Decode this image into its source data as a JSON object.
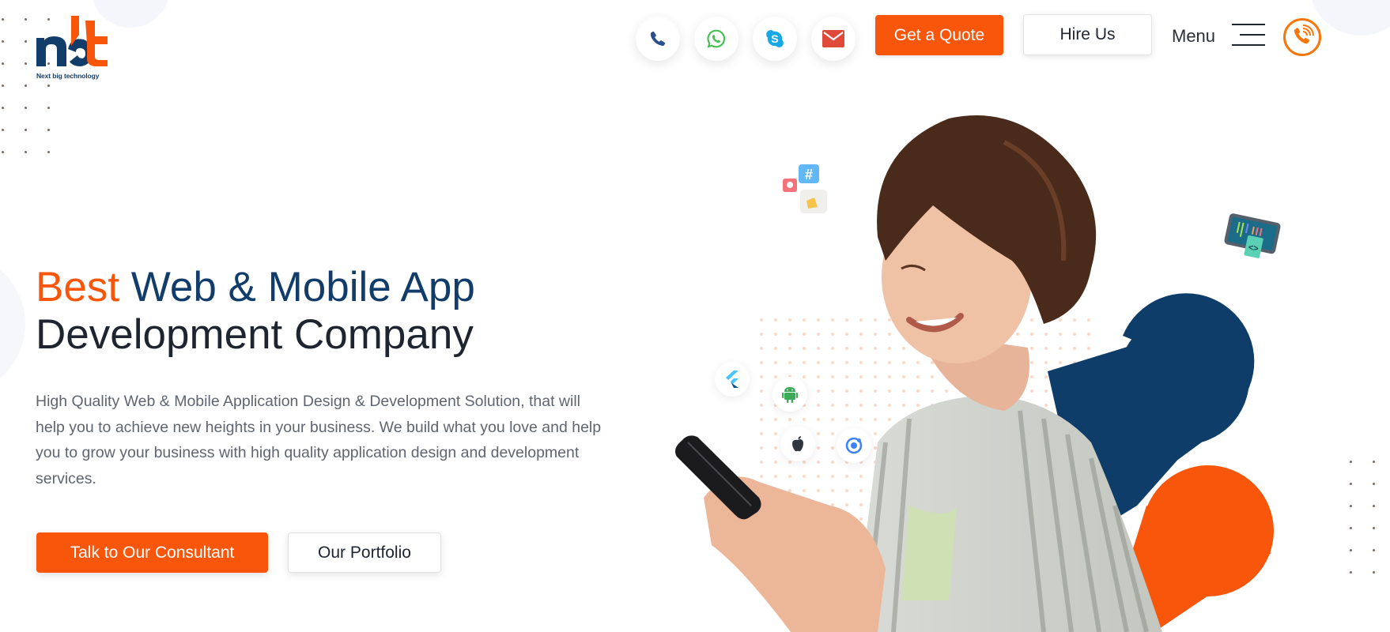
{
  "brand": {
    "logo_text": "nbt",
    "tagline": "Next big technology",
    "colors": {
      "orange": "#f7560b",
      "navy": "#123d6a",
      "text": "#1f2530",
      "muted": "#5f6570"
    }
  },
  "header": {
    "contact_icons": [
      {
        "name": "phone-icon",
        "color": "#2b4f8c"
      },
      {
        "name": "whatsapp-icon",
        "color": "#45c153"
      },
      {
        "name": "skype-icon",
        "color": "#17a8e6"
      },
      {
        "name": "email-icon",
        "color": "#e04a3a"
      }
    ],
    "get_quote_label": "Get a Quote",
    "hire_us_label": "Hire Us",
    "menu_label": "Menu"
  },
  "hero": {
    "title_accent": "Best",
    "title_highlight": "Web & Mobile App",
    "title_line2": "Development Company",
    "description": "High Quality Web & Mobile Application Design & Development Solution, that will help you to achieve new heights in your business. We build what you love and help you to grow your business with high quality application design and development services.",
    "primary_cta": "Talk to Our Consultant",
    "secondary_cta": "Our Portfolio",
    "tech_badges": [
      "flutter-icon",
      "android-icon",
      "apple-icon",
      "ionic-icon"
    ]
  }
}
